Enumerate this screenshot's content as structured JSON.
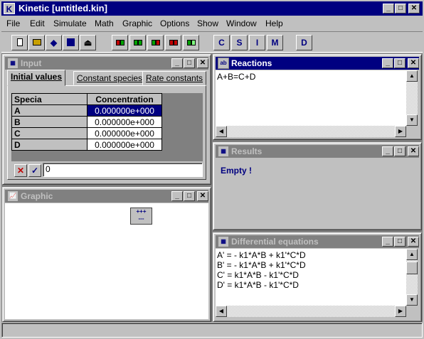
{
  "app": {
    "title": "Kinetic [untitled.kin]",
    "icon_letter": "K"
  },
  "menu": [
    {
      "label": "File"
    },
    {
      "label": "Edit"
    },
    {
      "label": "Simulate"
    },
    {
      "label": "Math"
    },
    {
      "label": "Graphic"
    },
    {
      "label": "Options"
    },
    {
      "label": "Show"
    },
    {
      "label": "Window"
    },
    {
      "label": "Help"
    }
  ],
  "toolbar": {
    "mode_buttons": [
      "C",
      "S",
      "I",
      "M",
      "D"
    ]
  },
  "input_window": {
    "title": "Input",
    "tabs": [
      "Initial values",
      "Constant species",
      "Rate constants"
    ],
    "selected_tab": "Initial values",
    "grid": {
      "headers": [
        "Specia",
        "Concentration"
      ],
      "rows": [
        {
          "species": "A",
          "value": "0.000000e+000"
        },
        {
          "species": "B",
          "value": "0.000000e+000"
        },
        {
          "species": "C",
          "value": "0.000000e+000"
        },
        {
          "species": "D",
          "value": "0.000000e+000"
        }
      ]
    },
    "edit_value": "0"
  },
  "reactions_window": {
    "title": "Reactions",
    "text": "A+B=C+D"
  },
  "results_window": {
    "title": "Results",
    "text": "Empty !"
  },
  "graphic_window": {
    "title": "Graphic",
    "palette_top": "+++",
    "palette_bottom": "---"
  },
  "diffeq_window": {
    "title": "Differential equations",
    "lines": [
      "A' = - k1*A*B + k1'*C*D",
      "B' = - k1*A*B + k1'*C*D",
      "C' = k1*A*B - k1'*C*D",
      "D' = k1*A*B - k1'*C*D"
    ]
  },
  "colors": {
    "active_title": "#000080",
    "inactive_title": "#808080",
    "face": "#c0c0c0"
  }
}
